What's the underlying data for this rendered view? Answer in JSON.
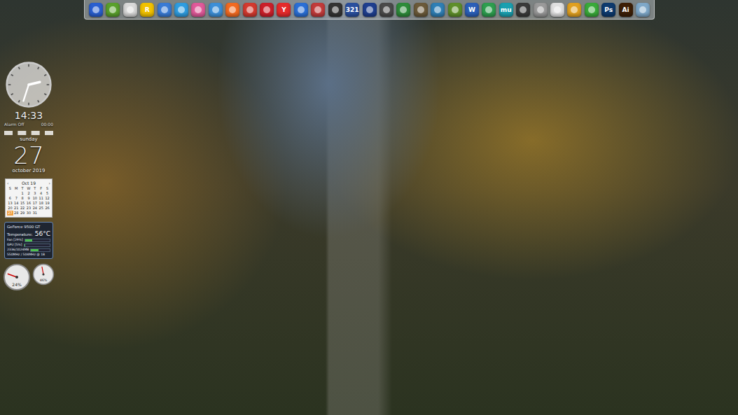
{
  "desktop": {
    "wallpaper": "forest stairs photo"
  },
  "dock": [
    {
      "kind": "glyph",
      "color": "#2a5fd0",
      "label": ""
    },
    {
      "kind": "glyph",
      "color": "#5aa02c",
      "label": ""
    },
    {
      "kind": "glyph",
      "color": "#d9d9d9",
      "label": ""
    },
    {
      "kind": "letter",
      "color": "#f2c200",
      "label": "R"
    },
    {
      "kind": "glyph",
      "color": "#3a7bd5",
      "label": ""
    },
    {
      "kind": "glyph",
      "color": "#2f9de0",
      "label": ""
    },
    {
      "kind": "glyph",
      "color": "#e05a9a",
      "label": ""
    },
    {
      "kind": "glyph",
      "color": "#3d8fd8",
      "label": ""
    },
    {
      "kind": "glyph",
      "color": "#f26a21",
      "label": ""
    },
    {
      "kind": "glyph",
      "color": "#d33a2f",
      "label": ""
    },
    {
      "kind": "glyph",
      "color": "#cc1f2a",
      "label": ""
    },
    {
      "kind": "letter",
      "color": "#e52b2b",
      "label": "Y"
    },
    {
      "kind": "glyph",
      "color": "#2b6fd6",
      "label": ""
    },
    {
      "kind": "glyph",
      "color": "#c23b3b",
      "label": ""
    },
    {
      "kind": "glyph",
      "color": "#333333",
      "label": ""
    },
    {
      "kind": "letter",
      "color": "#2a4f9e",
      "label": "321"
    },
    {
      "kind": "glyph",
      "color": "#1f3f8f",
      "label": ""
    },
    {
      "kind": "glyph",
      "color": "#4a4a4a",
      "label": ""
    },
    {
      "kind": "glyph",
      "color": "#2e8b3a",
      "label": ""
    },
    {
      "kind": "glyph",
      "color": "#6b5a3a",
      "label": ""
    },
    {
      "kind": "glyph",
      "color": "#2f7fb5",
      "label": ""
    },
    {
      "kind": "glyph",
      "color": "#5f8f2a",
      "label": ""
    },
    {
      "kind": "letter",
      "color": "#2b5fb8",
      "label": "W"
    },
    {
      "kind": "glyph",
      "color": "#2e9e4f",
      "label": ""
    },
    {
      "kind": "letter",
      "color": "#1aa0b0",
      "label": "mu"
    },
    {
      "kind": "glyph",
      "color": "#3a3a3a",
      "label": ""
    },
    {
      "kind": "glyph",
      "color": "#9a9a9a",
      "label": ""
    },
    {
      "kind": "glyph",
      "color": "#e0e0e0",
      "label": ""
    },
    {
      "kind": "glyph",
      "color": "#e0a020",
      "label": ""
    },
    {
      "kind": "glyph",
      "color": "#3aaa3a",
      "label": ""
    },
    {
      "kind": "letter",
      "color": "#0e3a6e",
      "label": "Ps"
    },
    {
      "kind": "letter",
      "color": "#3d1f06",
      "label": "Ai"
    },
    {
      "kind": "glyph",
      "color": "#7fa8c8",
      "label": ""
    }
  ],
  "clock": {
    "time": "14:33",
    "alarm": "Alarm Off",
    "alarm_time": "00:00",
    "hour": 2.55,
    "minute": 33
  },
  "date": {
    "weekday": "sunday",
    "day": "27",
    "month": "october 2019"
  },
  "calendar": {
    "title": "Oct 19",
    "prev": "‹",
    "next": "›",
    "weekdays": [
      "S",
      "M",
      "T",
      "W",
      "T",
      "F",
      "S"
    ],
    "days": [
      {
        "label": "",
        "selected": false
      },
      {
        "label": "",
        "selected": false
      },
      {
        "label": "1",
        "selected": false
      },
      {
        "label": "2",
        "selected": false
      },
      {
        "label": "3",
        "selected": false
      },
      {
        "label": "4",
        "selected": false
      },
      {
        "label": "5",
        "selected": false
      },
      {
        "label": "6",
        "selected": false
      },
      {
        "label": "7",
        "selected": false
      },
      {
        "label": "8",
        "selected": false
      },
      {
        "label": "9",
        "selected": false
      },
      {
        "label": "10",
        "selected": false
      },
      {
        "label": "11",
        "selected": false
      },
      {
        "label": "12",
        "selected": false
      },
      {
        "label": "13",
        "selected": false
      },
      {
        "label": "14",
        "selected": false
      },
      {
        "label": "15",
        "selected": false
      },
      {
        "label": "16",
        "selected": false
      },
      {
        "label": "17",
        "selected": false
      },
      {
        "label": "18",
        "selected": false
      },
      {
        "label": "19",
        "selected": false
      },
      {
        "label": "20",
        "selected": false
      },
      {
        "label": "21",
        "selected": false
      },
      {
        "label": "22",
        "selected": false
      },
      {
        "label": "23",
        "selected": false
      },
      {
        "label": "24",
        "selected": false
      },
      {
        "label": "25",
        "selected": false
      },
      {
        "label": "26",
        "selected": false
      },
      {
        "label": "27",
        "selected": true
      },
      {
        "label": "28",
        "selected": false
      },
      {
        "label": "29",
        "selected": false
      },
      {
        "label": "30",
        "selected": false
      },
      {
        "label": "31",
        "selected": false
      },
      {
        "label": "",
        "selected": false
      },
      {
        "label": "",
        "selected": false
      }
    ]
  },
  "gpu": {
    "name": "GeForce 9500 GT",
    "temperature_label": "Temperature:",
    "temperature": "56°C",
    "meters": [
      {
        "label": "Fan [29%]",
        "level": 0.29
      },
      {
        "label": "GPU [5%]",
        "level": 0.05
      },
      {
        "label": "2336/1024MB",
        "level": 0.4
      }
    ],
    "clock": "550MHz / 504MHz @ 1B"
  },
  "gauges": [
    {
      "reading": "24%",
      "level": 0.24
    },
    {
      "reading": "46%",
      "level": 0.46
    }
  ]
}
